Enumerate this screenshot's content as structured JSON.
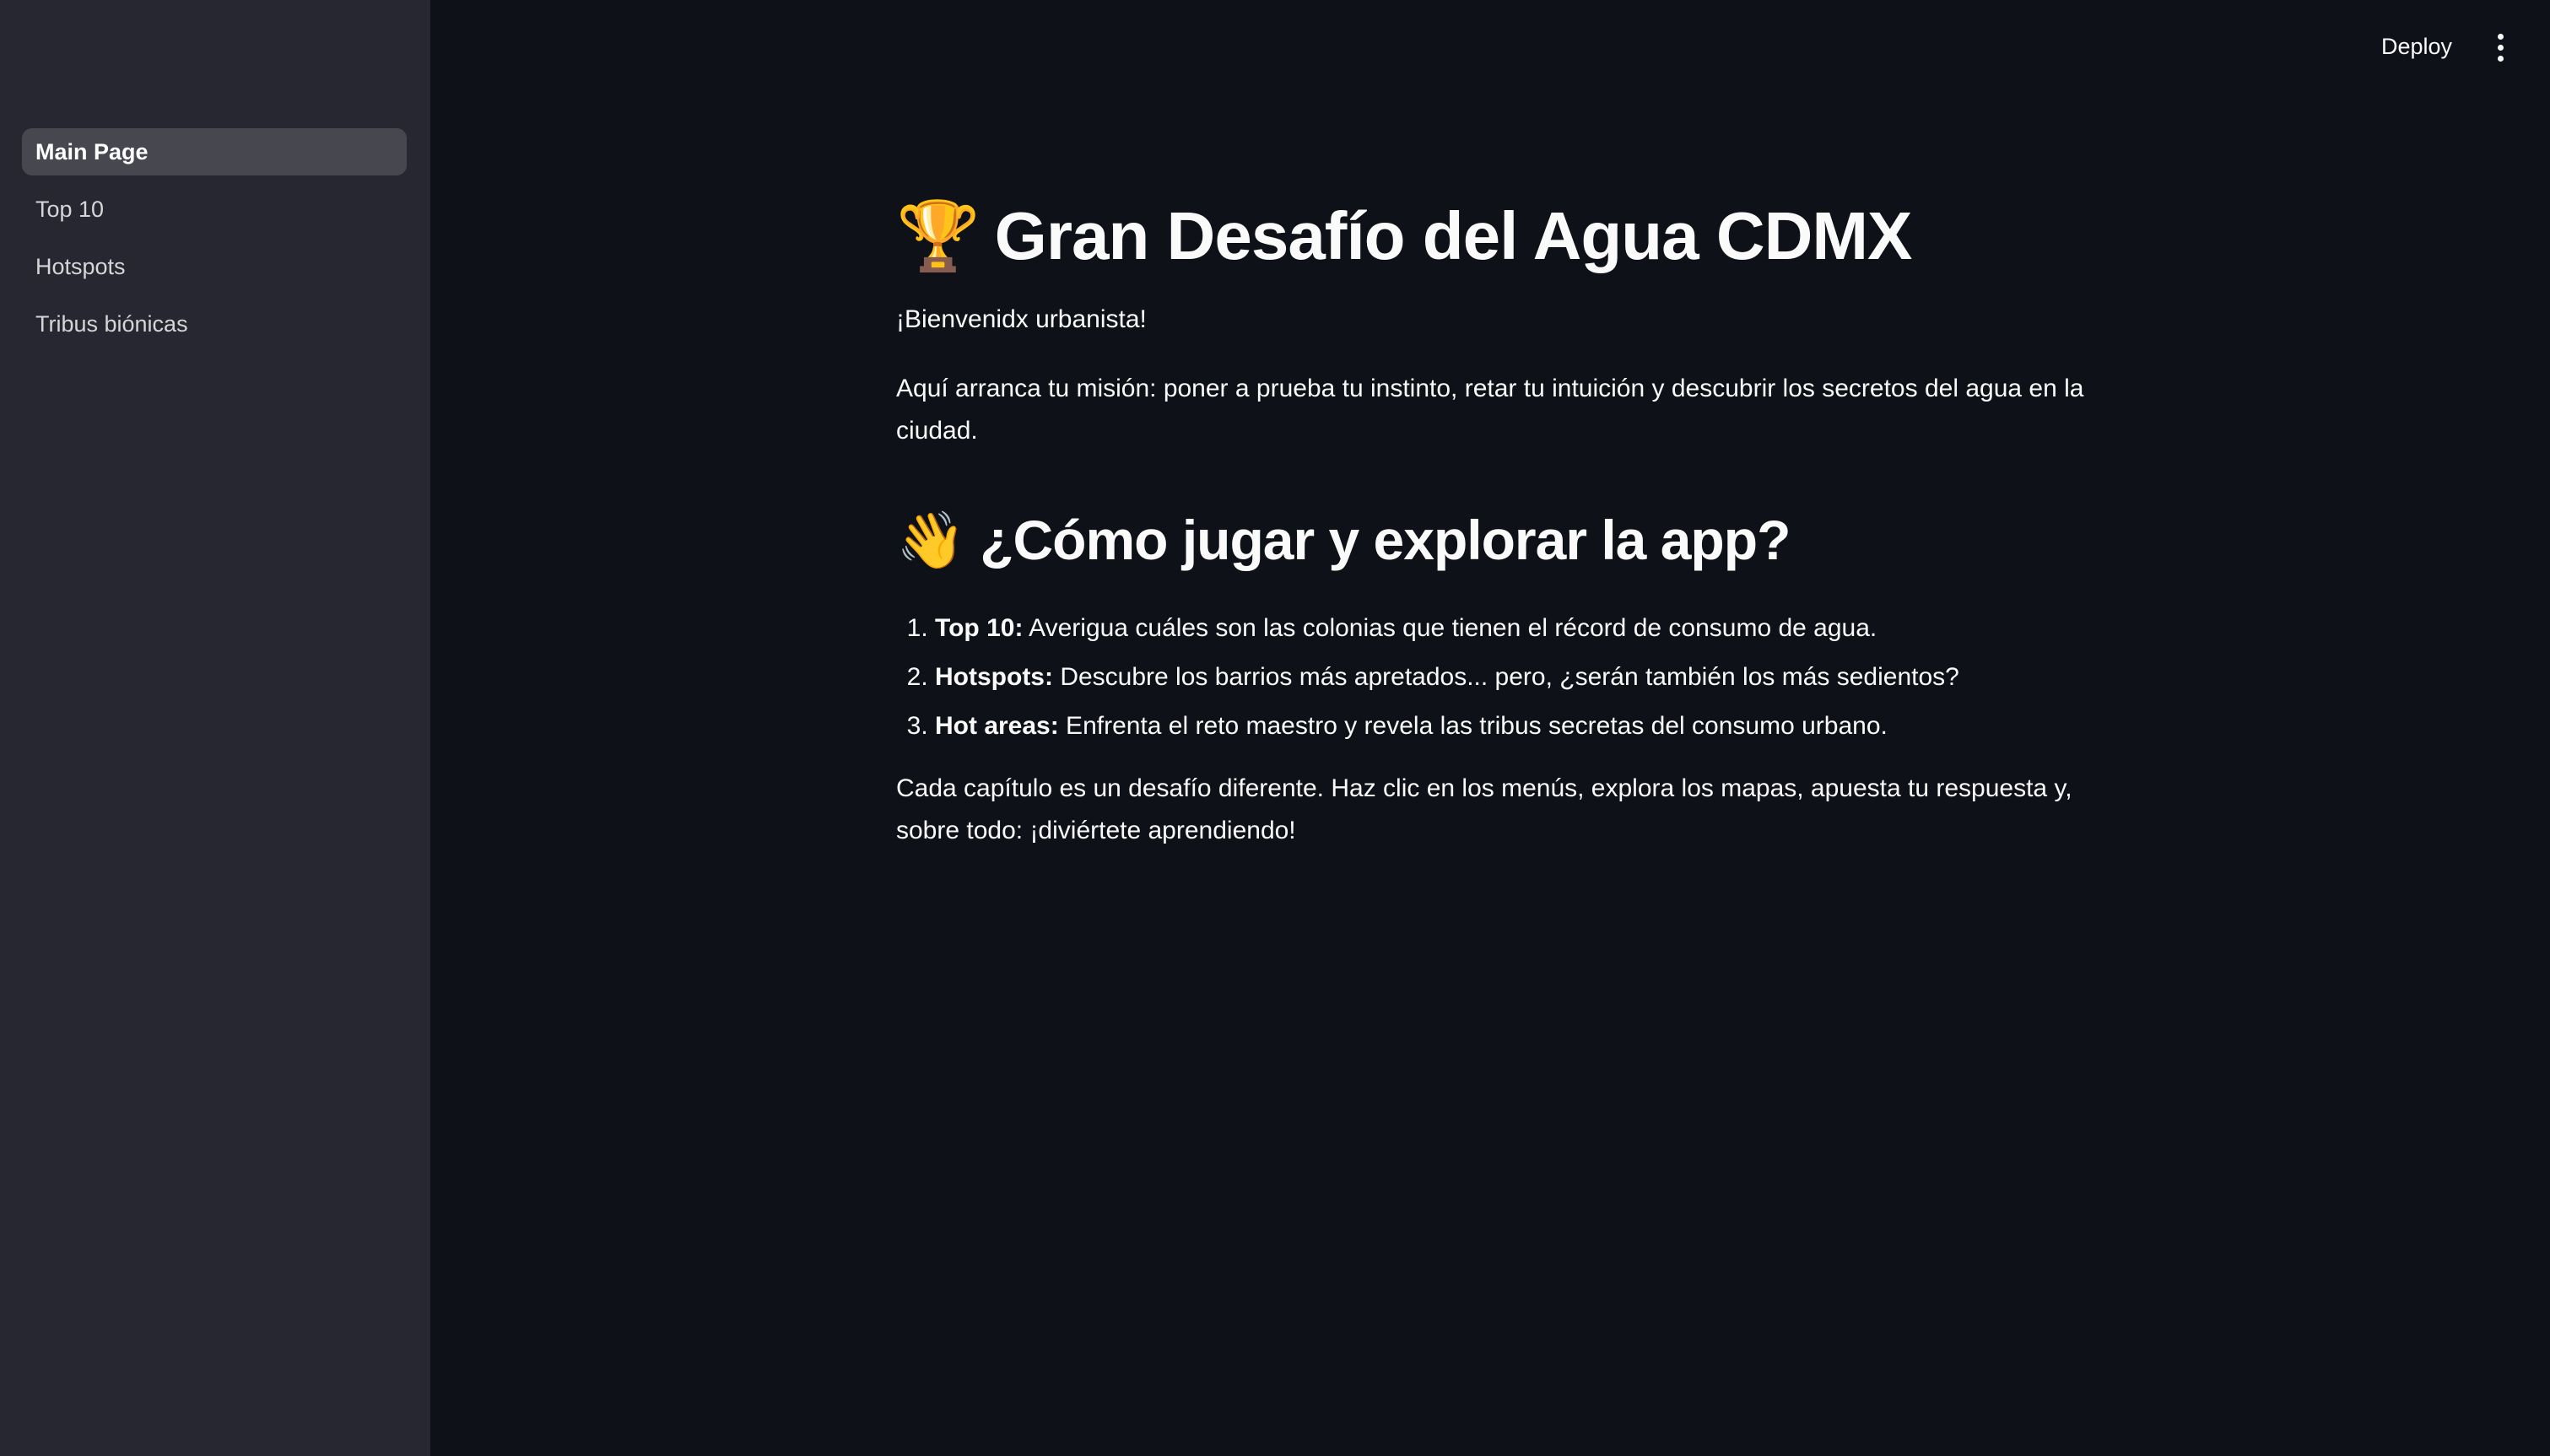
{
  "sidebar": {
    "items": [
      {
        "label": "Main Page",
        "active": true
      },
      {
        "label": "Top 10",
        "active": false
      },
      {
        "label": "Hotspots",
        "active": false
      },
      {
        "label": "Tribus biónicas",
        "active": false
      }
    ]
  },
  "header": {
    "deploy_label": "Deploy",
    "menu_icon": "vertical-dots-icon"
  },
  "main": {
    "title_emoji": "🏆",
    "title": "Gran Desafío del Agua CDMX",
    "welcome": "¡Bienvenidx urbanista!",
    "intro": "Aquí arranca tu misión: poner a prueba tu instinto, retar tu intuición y descubrir los secretos del agua en la ciudad.",
    "how_emoji": "👋",
    "how_title": "¿Cómo jugar y explorar la app?",
    "steps": [
      {
        "term": "Top 10:",
        "text": " Averigua cuáles son las colonias que tienen el récord de consumo de agua."
      },
      {
        "term": "Hotspots:",
        "text": " Descubre los barrios más apretados... pero, ¿serán también los más sedientos?"
      },
      {
        "term": "Hot areas:",
        "text": " Enfrenta el reto maestro y revela las tribus secretas del consumo urbano."
      }
    ],
    "outro": "Cada capítulo es un desafío diferente. Haz clic en los menús, explora los mapas, apuesta tu respuesta y, sobre todo: ¡diviértete aprendiendo!"
  },
  "colors": {
    "background": "#0e1117",
    "sidebar": "#262730",
    "active_item": "#46474f",
    "text": "#fafafa"
  }
}
